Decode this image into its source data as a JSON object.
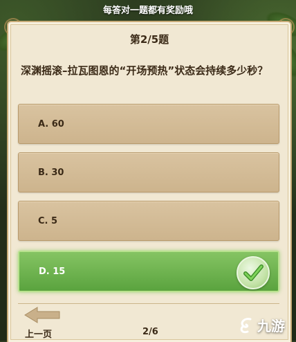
{
  "banner": {
    "text": "每答对一题都有奖励哦"
  },
  "quiz": {
    "progress": "第2/5题",
    "question": "深渊摇滚–拉瓦图恩的“开场预热”状态会持续多少秒？",
    "options": [
      {
        "label": "A. 60",
        "state": "normal"
      },
      {
        "label": "B. 30",
        "state": "normal"
      },
      {
        "label": "C. 5",
        "state": "normal"
      },
      {
        "label": "D. 15",
        "state": "correct"
      }
    ],
    "correct_icon": "check-icon"
  },
  "footer": {
    "prev_label": "上一页",
    "page": "2/6",
    "back_icon": "back-arrow-icon"
  },
  "watermark": {
    "text": "九游",
    "logo_icon": "jiuyou-logo-icon"
  },
  "colors": {
    "panel": "#f1e8d3",
    "option": "#d9c3a0",
    "correct": "#6fb54f",
    "text": "#3b2a17"
  }
}
